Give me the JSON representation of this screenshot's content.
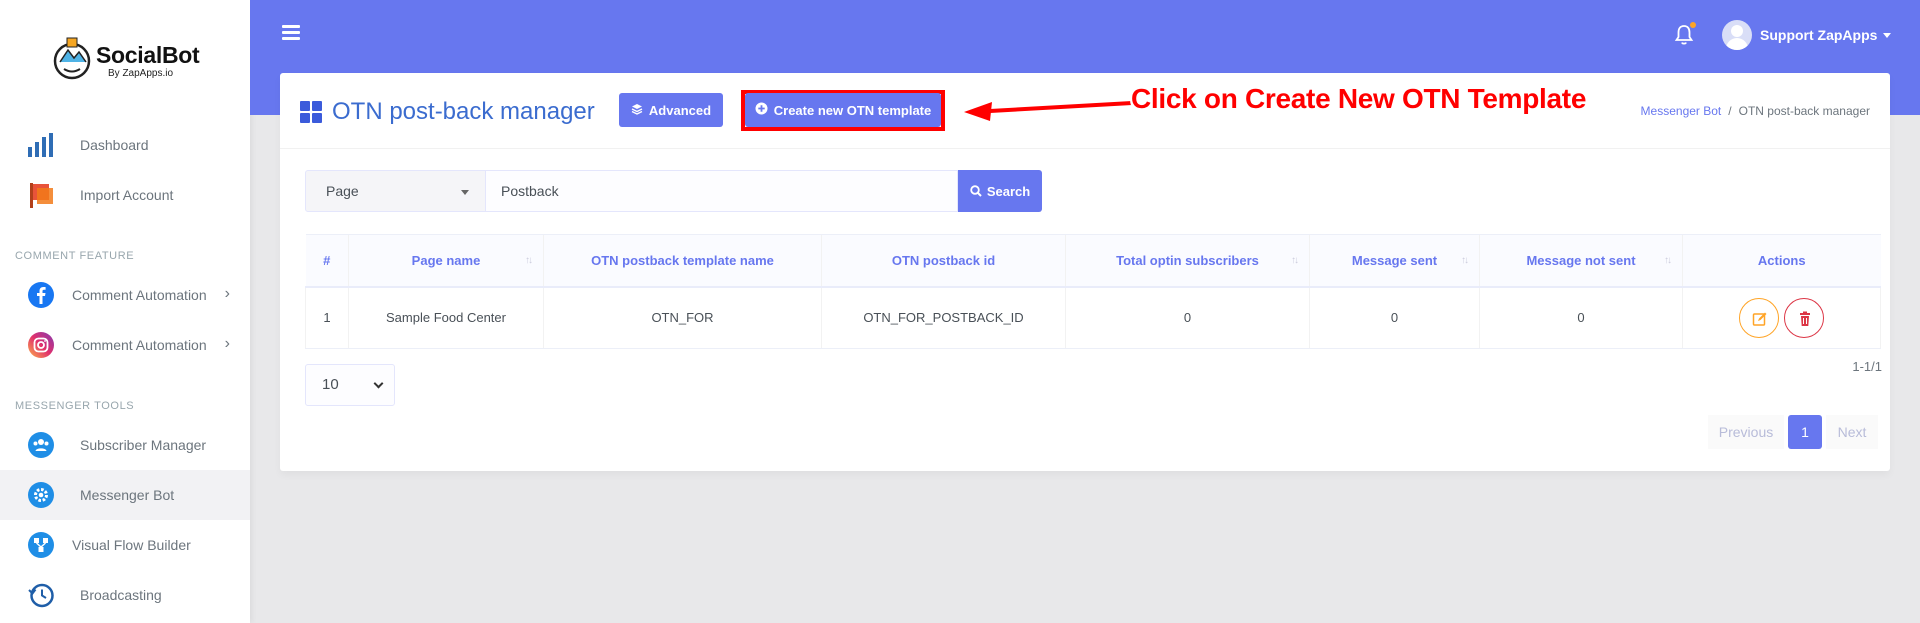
{
  "brand": {
    "title": "SocialBot",
    "subtitle": "By ZapApps.io"
  },
  "sidebar": {
    "items": [
      {
        "label": "Dashboard",
        "icon": "bar-chart-icon"
      },
      {
        "label": "Import Account",
        "icon": "flag-icon"
      }
    ],
    "section1": "COMMENT FEATURE",
    "comment_items": [
      {
        "label": "Comment Automation",
        "icon": "facebook-icon"
      },
      {
        "label": "Comment Automation",
        "icon": "instagram-icon"
      }
    ],
    "section2": "MESSENGER TOOLS",
    "messenger_items": [
      {
        "label": "Subscriber Manager",
        "icon": "users-icon"
      },
      {
        "label": "Messenger Bot",
        "icon": "gear-icon"
      },
      {
        "label": "Visual Flow Builder",
        "icon": "flow-icon"
      },
      {
        "label": "Broadcasting",
        "icon": "history-icon"
      }
    ]
  },
  "topbar": {
    "user_name": "Support ZapApps"
  },
  "header": {
    "title": "OTN post-back manager",
    "advanced_label": "Advanced",
    "create_label": "Create new OTN template",
    "callout": "Click on Create New OTN Template",
    "breadcrumb": {
      "parent": "Messenger Bot",
      "current": "OTN post-back manager"
    }
  },
  "search": {
    "page_select": "Page",
    "input_value": "Postback",
    "button_label": "Search"
  },
  "table": {
    "columns": [
      "#",
      "Page name",
      "OTN postback template name",
      "OTN postback id",
      "Total optin subscribers",
      "Message sent",
      "Message not sent",
      "Actions"
    ],
    "rows": [
      [
        "1",
        "Sample Food Center",
        "OTN_FOR",
        "OTN_FOR_POSTBACK_ID",
        "0",
        "0",
        "0"
      ]
    ]
  },
  "pagination": {
    "page_length": "10",
    "info": "1-1/1",
    "previous": "Previous",
    "current": "1",
    "next": "Next"
  },
  "colors": {
    "primary": "#6777ef",
    "highlight": "#ff0000",
    "edit": "#ffa426",
    "delete": "#dc3545"
  }
}
